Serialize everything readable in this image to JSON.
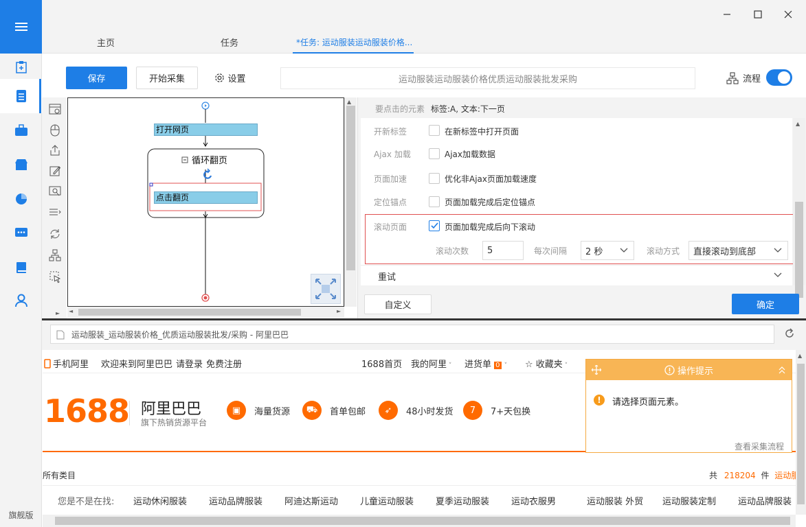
{
  "sidebar": {
    "bottom_label": "旗舰版"
  },
  "tabs": [
    {
      "label": "主页"
    },
    {
      "label": "任务"
    },
    {
      "label": "*任务: 运动服装运动服装价格..."
    }
  ],
  "toolbar": {
    "save": "保存",
    "start": "开始采集",
    "settings": "设置",
    "url": "运动服装运动服装价格优质运动服装批发采购",
    "flow": "流程"
  },
  "flow": {
    "open_page": "打开网页",
    "loop_page": "循环翻页",
    "click_page": "点击翻页"
  },
  "panel": {
    "target_label": "要点击的元素",
    "target_value": "标签:A, 文本:下一页",
    "rows": [
      {
        "label": "开新标签",
        "text": "在新标签中打开页面"
      },
      {
        "label": "Ajax 加载",
        "text": "Ajax加载数据"
      },
      {
        "label": "页面加速",
        "text": "优化非Ajax页面加载速度"
      },
      {
        "label": "定位锚点",
        "text": "页面加载完成后定位锚点"
      }
    ],
    "scroll_label": "滚动页面",
    "scroll_text": "页面加载完成后向下滚动",
    "scroll_count_label": "滚动次数",
    "scroll_count": "5",
    "interval_label": "每次间隔",
    "interval": "2 秒",
    "method_label": "滚动方式",
    "method": "直接滚动到底部",
    "retry": "重试",
    "custom": "自定义",
    "confirm": "确定"
  },
  "browser": {
    "address": "运动服装_运动服装价格_优质运动服装批发/采购 - 阿里巴巴"
  },
  "web": {
    "mobile": "手机阿里",
    "welcome": "欢迎来到阿里巴巴",
    "login": "请登录",
    "register": "免费注册",
    "home": "1688首页",
    "my": "我的阿里",
    "stock": "进货单",
    "stock_count": "0",
    "fav": "收藏夹",
    "logo_num": "1688",
    "logo_name": "阿里巴巴",
    "logo_sub": "旗下热销货源平台",
    "features": [
      "海量货源",
      "首单包邮",
      "48小时发货",
      "7+天包换"
    ],
    "all_cats": "所有类目",
    "total_prefix": "共",
    "total_count": "218204",
    "total_suffix": "件",
    "total_kw": "运动服",
    "ask": "您是不是在找:",
    "suggestions": [
      "运动休闲服装",
      "运动品牌服装",
      "阿迪达斯运动",
      "儿童运动服装",
      "夏季运动服装",
      "运动衣服男",
      "运动服装 外贸",
      "运动服装定制",
      "运动品牌服装"
    ]
  },
  "tip": {
    "title": "操作提示",
    "message": "请选择页面元素。",
    "link": "查看采集流程"
  },
  "colors": {
    "accent": "#1e7ee6",
    "orange": "#ff6a00",
    "tip": "#f8b555",
    "flow_node": "#89cde8"
  }
}
